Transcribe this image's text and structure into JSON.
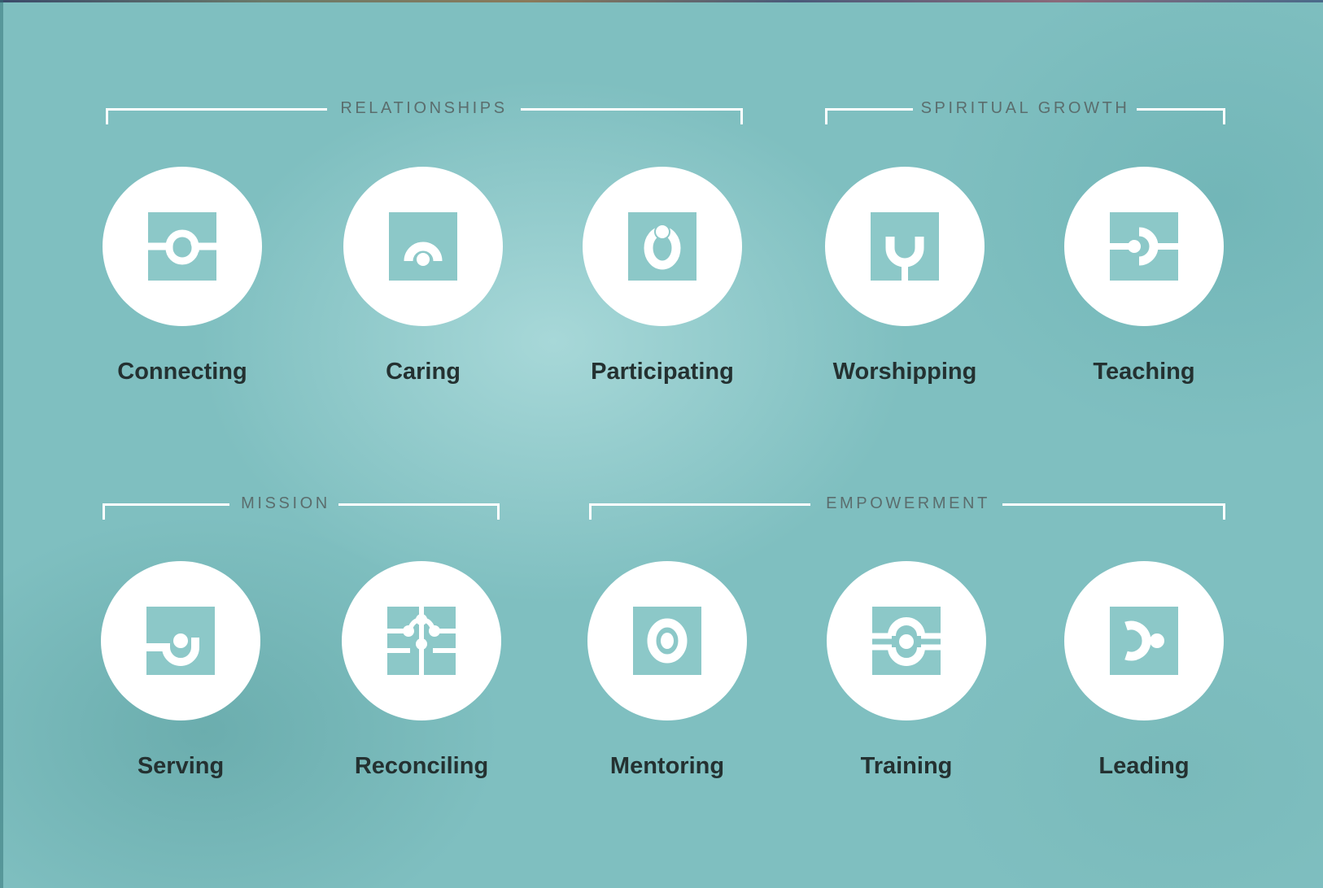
{
  "colors": {
    "background": "#7fbfc0",
    "icon_fill": "#8cc8c8",
    "circle": "#ffffff",
    "label": "#243131",
    "group_label": "#5b6d6d"
  },
  "groups": {
    "relationships": "RELATIONSHIPS",
    "spiritual_growth": "SPIRITUAL GROWTH",
    "mission": "MISSION",
    "empowerment": "EMPOWERMENT"
  },
  "items": {
    "connecting": {
      "label": "Connecting",
      "icon": "connecting-icon"
    },
    "caring": {
      "label": "Caring",
      "icon": "caring-icon"
    },
    "participating": {
      "label": "Participating",
      "icon": "participating-icon"
    },
    "worshipping": {
      "label": "Worshipping",
      "icon": "worshipping-icon"
    },
    "teaching": {
      "label": "Teaching",
      "icon": "teaching-icon"
    },
    "serving": {
      "label": "Serving",
      "icon": "serving-icon"
    },
    "reconciling": {
      "label": "Reconciling",
      "icon": "reconciling-icon"
    },
    "mentoring": {
      "label": "Mentoring",
      "icon": "mentoring-icon"
    },
    "training": {
      "label": "Training",
      "icon": "training-icon"
    },
    "leading": {
      "label": "Leading",
      "icon": "leading-icon"
    }
  }
}
